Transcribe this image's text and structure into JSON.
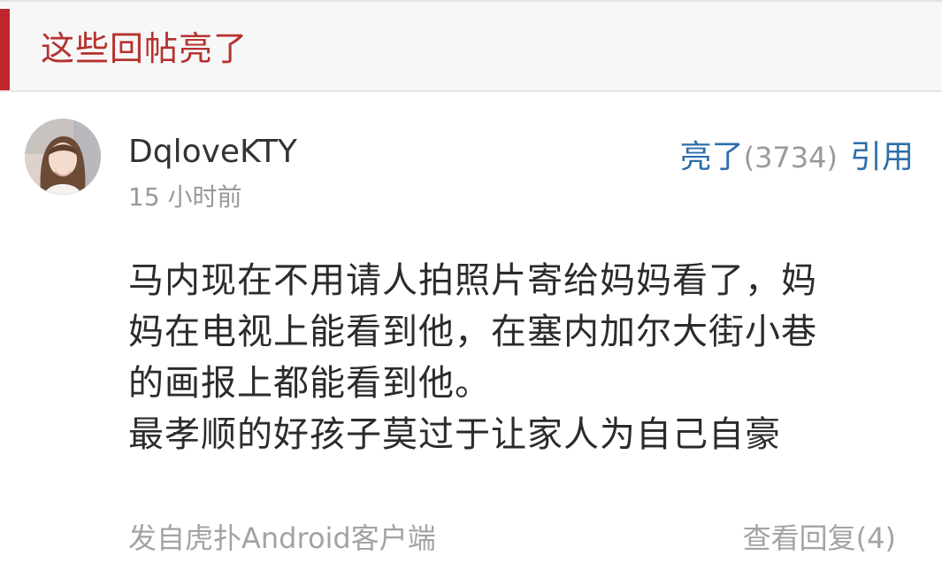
{
  "section": {
    "title": "这些回帖亮了",
    "accent_color": "#c0272d"
  },
  "post": {
    "avatar_icon": "user-avatar-photo",
    "username": "DqloveKTY",
    "time": "15 小时前",
    "light_label": "亮了",
    "light_count": "(3734)",
    "quote_label": "引用",
    "content_lines": [
      "马内现在不用请人拍照片寄给妈妈看了，妈",
      "妈在电视上能看到他，在塞内加尔大街小巷",
      "的画报上都能看到他。",
      "最孝顺的好孩子莫过于让家人为自己自豪"
    ],
    "source": "发自虎扑Android客户端",
    "replies_label": "查看回复(4)"
  },
  "colors": {
    "link": "#2d6eaa",
    "muted": "#999999",
    "text": "#2b2b2b"
  }
}
